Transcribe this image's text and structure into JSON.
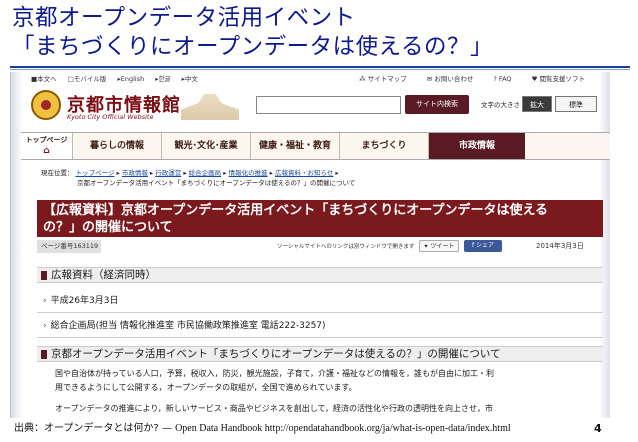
{
  "slide": {
    "title_line1": "京都オープンデータ活用イベント",
    "title_line2": "「まちづくりにオープンデータは使えるの？」",
    "caption_prefix": "出典：オープンデータとは何か? — ",
    "caption_source": "Open Data Handbook   http://opendatahandbook.org/ja/what-is-open-data/index.html",
    "page_number": "4"
  },
  "site": {
    "util_left": [
      "■本文へ",
      "□モバイル版",
      "▸English",
      "▸한글",
      "▸中文"
    ],
    "util_right": [
      "サイトマップ",
      "お問い合わせ",
      "FAQ",
      "閲覧支援ソフト"
    ],
    "brand_name": "京都市情報館",
    "brand_sub": "Kyoto City Official Website",
    "search": {
      "placeholder": "",
      "button": "サイト内検索"
    },
    "fontsize": {
      "label": "文字の大きさ",
      "large": "拡大",
      "normal": "標準"
    },
    "nav": {
      "home_line1": "トップページ",
      "home_icon": "⌂",
      "items": [
        "暮らしの情報",
        "観光･文化･産業",
        "健康・福祉・教育",
        "まちづくり"
      ],
      "active": "市政情報"
    },
    "breadcrumb": {
      "label": "現在位置：",
      "links": [
        "トップページ",
        "市政情報",
        "行政運営",
        "総合企画局",
        "情報化の推進",
        "広報資料・お知らせ"
      ],
      "current": "京都オープンデータ活用イベント「まちづくりにオープンデータは使えるの？」の開催について"
    },
    "article": {
      "headline_line1": "【広報資料】京都オープンデータ活用イベント「まちづくりにオープンデータは使える",
      "headline_line2": "の？」の開催について",
      "page_number": "ページ番号163119",
      "social_note": "ソーシャルサイトへのリンクは別ウィンドウで開きます",
      "tweet": "ツイート",
      "share": "f シェア",
      "date": "2014年3月3日",
      "section1": "広報資料（経済同時）",
      "date_line": "平成26年3月3日",
      "contact_line": "総合企画局(担当 情報化推進室 市民協働政策推進室 電話222-3257)",
      "section2": "京都オープンデータ活用イベント「まちづくりにオープンデータは使えるの？」の開催について",
      "body1": "国や自治体が持っている人口，予算，税収入，防災，観光施設，子育て，介護・福祉などの情報を，誰もが自由に加工・利",
      "body2": "用できるようにして公開する，オープンデータの取組が，全国で進められています。",
      "body3": "オープンデータの推進により，新しいサービス・商品やビジネスを創出して，経済の活性化や行政の透明性を向上させ，市"
    }
  }
}
